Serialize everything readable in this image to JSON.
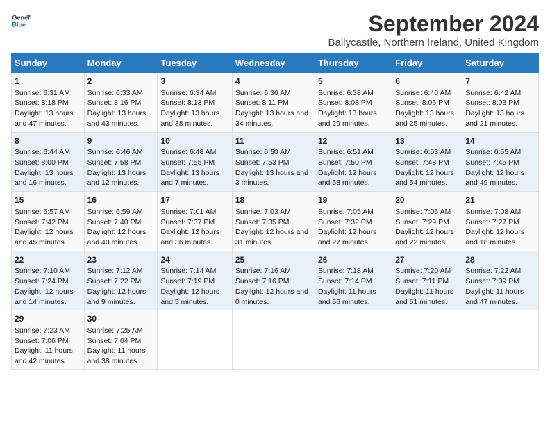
{
  "header": {
    "logo_general": "General",
    "logo_blue": "Blue",
    "title": "September 2024",
    "subtitle": "Ballycastle, Northern Ireland, United Kingdom"
  },
  "columns": [
    "Sunday",
    "Monday",
    "Tuesday",
    "Wednesday",
    "Thursday",
    "Friday",
    "Saturday"
  ],
  "rows": [
    [
      {
        "day": "1",
        "sunrise": "Sunrise: 6:31 AM",
        "sunset": "Sunset: 8:18 PM",
        "daylight": "Daylight: 13 hours and 47 minutes."
      },
      {
        "day": "2",
        "sunrise": "Sunrise: 6:33 AM",
        "sunset": "Sunset: 8:16 PM",
        "daylight": "Daylight: 13 hours and 43 minutes."
      },
      {
        "day": "3",
        "sunrise": "Sunrise: 6:34 AM",
        "sunset": "Sunset: 8:13 PM",
        "daylight": "Daylight: 13 hours and 38 minutes."
      },
      {
        "day": "4",
        "sunrise": "Sunrise: 6:36 AM",
        "sunset": "Sunset: 8:11 PM",
        "daylight": "Daylight: 13 hours and 34 minutes."
      },
      {
        "day": "5",
        "sunrise": "Sunrise: 6:38 AM",
        "sunset": "Sunset: 8:08 PM",
        "daylight": "Daylight: 13 hours and 29 minutes."
      },
      {
        "day": "6",
        "sunrise": "Sunrise: 6:40 AM",
        "sunset": "Sunset: 8:06 PM",
        "daylight": "Daylight: 13 hours and 25 minutes."
      },
      {
        "day": "7",
        "sunrise": "Sunrise: 6:42 AM",
        "sunset": "Sunset: 8:03 PM",
        "daylight": "Daylight: 13 hours and 21 minutes."
      }
    ],
    [
      {
        "day": "8",
        "sunrise": "Sunrise: 6:44 AM",
        "sunset": "Sunset: 8:00 PM",
        "daylight": "Daylight: 13 hours and 16 minutes."
      },
      {
        "day": "9",
        "sunrise": "Sunrise: 6:46 AM",
        "sunset": "Sunset: 7:58 PM",
        "daylight": "Daylight: 13 hours and 12 minutes."
      },
      {
        "day": "10",
        "sunrise": "Sunrise: 6:48 AM",
        "sunset": "Sunset: 7:55 PM",
        "daylight": "Daylight: 13 hours and 7 minutes."
      },
      {
        "day": "11",
        "sunrise": "Sunrise: 6:50 AM",
        "sunset": "Sunset: 7:53 PM",
        "daylight": "Daylight: 13 hours and 3 minutes."
      },
      {
        "day": "12",
        "sunrise": "Sunrise: 6:51 AM",
        "sunset": "Sunset: 7:50 PM",
        "daylight": "Daylight: 12 hours and 58 minutes."
      },
      {
        "day": "13",
        "sunrise": "Sunrise: 6:53 AM",
        "sunset": "Sunset: 7:48 PM",
        "daylight": "Daylight: 12 hours and 54 minutes."
      },
      {
        "day": "14",
        "sunrise": "Sunrise: 6:55 AM",
        "sunset": "Sunset: 7:45 PM",
        "daylight": "Daylight: 12 hours and 49 minutes."
      }
    ],
    [
      {
        "day": "15",
        "sunrise": "Sunrise: 6:57 AM",
        "sunset": "Sunset: 7:42 PM",
        "daylight": "Daylight: 12 hours and 45 minutes."
      },
      {
        "day": "16",
        "sunrise": "Sunrise: 6:59 AM",
        "sunset": "Sunset: 7:40 PM",
        "daylight": "Daylight: 12 hours and 40 minutes."
      },
      {
        "day": "17",
        "sunrise": "Sunrise: 7:01 AM",
        "sunset": "Sunset: 7:37 PM",
        "daylight": "Daylight: 12 hours and 36 minutes."
      },
      {
        "day": "18",
        "sunrise": "Sunrise: 7:03 AM",
        "sunset": "Sunset: 7:35 PM",
        "daylight": "Daylight: 12 hours and 31 minutes."
      },
      {
        "day": "19",
        "sunrise": "Sunrise: 7:05 AM",
        "sunset": "Sunset: 7:32 PM",
        "daylight": "Daylight: 12 hours and 27 minutes."
      },
      {
        "day": "20",
        "sunrise": "Sunrise: 7:06 AM",
        "sunset": "Sunset: 7:29 PM",
        "daylight": "Daylight: 12 hours and 22 minutes."
      },
      {
        "day": "21",
        "sunrise": "Sunrise: 7:08 AM",
        "sunset": "Sunset: 7:27 PM",
        "daylight": "Daylight: 12 hours and 18 minutes."
      }
    ],
    [
      {
        "day": "22",
        "sunrise": "Sunrise: 7:10 AM",
        "sunset": "Sunset: 7:24 PM",
        "daylight": "Daylight: 12 hours and 14 minutes."
      },
      {
        "day": "23",
        "sunrise": "Sunrise: 7:12 AM",
        "sunset": "Sunset: 7:22 PM",
        "daylight": "Daylight: 12 hours and 9 minutes."
      },
      {
        "day": "24",
        "sunrise": "Sunrise: 7:14 AM",
        "sunset": "Sunset: 7:19 PM",
        "daylight": "Daylight: 12 hours and 5 minutes."
      },
      {
        "day": "25",
        "sunrise": "Sunrise: 7:16 AM",
        "sunset": "Sunset: 7:16 PM",
        "daylight": "Daylight: 12 hours and 0 minutes."
      },
      {
        "day": "26",
        "sunrise": "Sunrise: 7:18 AM",
        "sunset": "Sunset: 7:14 PM",
        "daylight": "Daylight: 11 hours and 56 minutes."
      },
      {
        "day": "27",
        "sunrise": "Sunrise: 7:20 AM",
        "sunset": "Sunset: 7:11 PM",
        "daylight": "Daylight: 11 hours and 51 minutes."
      },
      {
        "day": "28",
        "sunrise": "Sunrise: 7:22 AM",
        "sunset": "Sunset: 7:09 PM",
        "daylight": "Daylight: 11 hours and 47 minutes."
      }
    ],
    [
      {
        "day": "29",
        "sunrise": "Sunrise: 7:23 AM",
        "sunset": "Sunset: 7:06 PM",
        "daylight": "Daylight: 11 hours and 42 minutes."
      },
      {
        "day": "30",
        "sunrise": "Sunrise: 7:25 AM",
        "sunset": "Sunset: 7:04 PM",
        "daylight": "Daylight: 11 hours and 38 minutes."
      },
      null,
      null,
      null,
      null,
      null
    ]
  ]
}
